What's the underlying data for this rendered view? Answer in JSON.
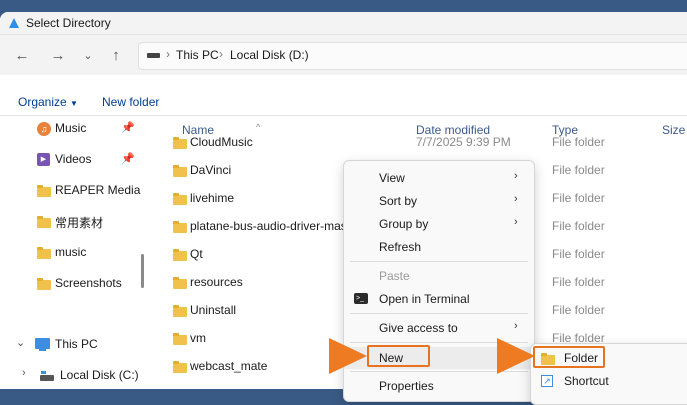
{
  "window": {
    "title": "Select Directory"
  },
  "address": {
    "crumbs": [
      "This PC",
      "Local Disk (D:)"
    ]
  },
  "commands": {
    "organize": "Organize",
    "new_folder": "New folder"
  },
  "sidebar": {
    "items": [
      {
        "label": "Music",
        "icon": "music-icon",
        "pinned": true
      },
      {
        "label": "Videos",
        "icon": "video-icon",
        "pinned": true
      },
      {
        "label": "REAPER Media",
        "icon": "folder-icon"
      },
      {
        "label": "常用素材",
        "icon": "folder-icon"
      },
      {
        "label": "music",
        "icon": "folder-icon"
      },
      {
        "label": "Screenshots",
        "icon": "folder-icon"
      },
      {
        "label": "This PC",
        "icon": "pc-icon"
      },
      {
        "label": "Local Disk (C:)",
        "icon": "disk-icon"
      }
    ]
  },
  "columns": {
    "name": "Name",
    "date": "Date modified",
    "type": "Type",
    "size": "Size"
  },
  "files": [
    {
      "name": "CloudMusic",
      "date": "7/7/2025 9:39 PM",
      "type": "File folder"
    },
    {
      "name": "DaVinci",
      "date": "",
      "type": "File folder"
    },
    {
      "name": "livehime",
      "date": "",
      "type": "File folder"
    },
    {
      "name": "platane-bus-audio-driver-mast",
      "date": "",
      "type": "File folder"
    },
    {
      "name": "Qt",
      "date": "",
      "type": "File folder"
    },
    {
      "name": "resources",
      "date": "",
      "type": "File folder"
    },
    {
      "name": "Uninstall",
      "date": "",
      "type": "File folder"
    },
    {
      "name": "vm",
      "date": "",
      "type": "File folder"
    },
    {
      "name": "webcast_mate",
      "date": "",
      "type": ""
    }
  ],
  "context_menu": {
    "view": "View",
    "sort_by": "Sort by",
    "group_by": "Group by",
    "refresh": "Refresh",
    "paste": "Paste",
    "open_terminal": "Open in Terminal",
    "give_access": "Give access to",
    "new": "New",
    "properties": "Properties"
  },
  "submenu": {
    "folder": "Folder",
    "shortcut": "Shortcut"
  },
  "colors": {
    "highlight": "#e8731e",
    "folder": "#f0c24b",
    "link": "#003e92"
  }
}
